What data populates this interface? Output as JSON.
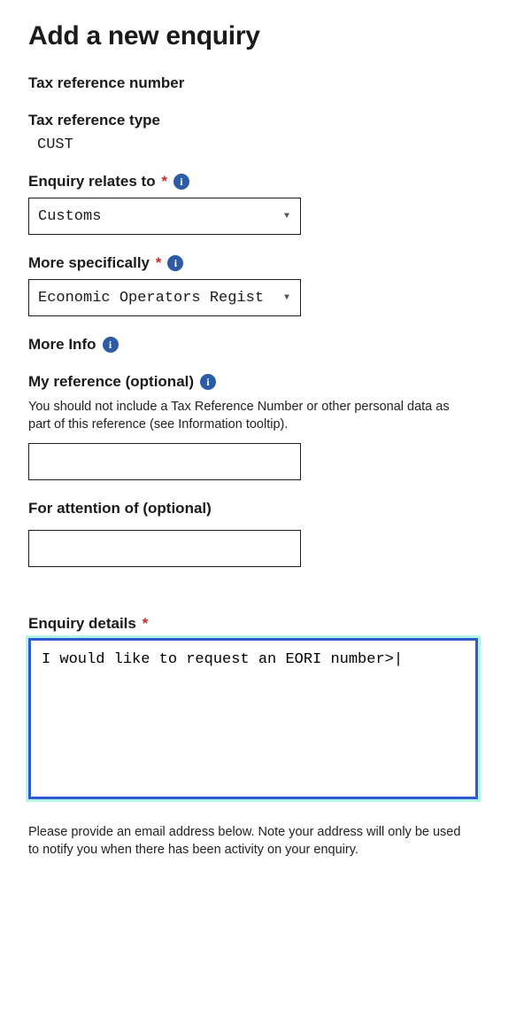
{
  "title": "Add a new enquiry",
  "taxRefNumber": {
    "label": "Tax reference number",
    "value": ""
  },
  "taxRefType": {
    "label": "Tax reference type",
    "value": "CUST"
  },
  "enquiryRelates": {
    "label": "Enquiry relates to",
    "selected": "Customs"
  },
  "moreSpecifically": {
    "label": "More specifically",
    "selected": "Economic Operators Regist"
  },
  "moreInfo": {
    "label": "More Info"
  },
  "myReference": {
    "label": "My reference (optional)",
    "help": "You should not include a Tax Reference Number or other personal data as part of this reference (see Information tooltip).",
    "value": ""
  },
  "forAttention": {
    "label": "For attention of (optional)",
    "value": ""
  },
  "enquiryDetails": {
    "label": "Enquiry details",
    "value": "I would like to request an EORI number>|"
  },
  "emailNote": "Please provide an email address below. Note your address will only be used to notify you when there has been activity on your enquiry."
}
